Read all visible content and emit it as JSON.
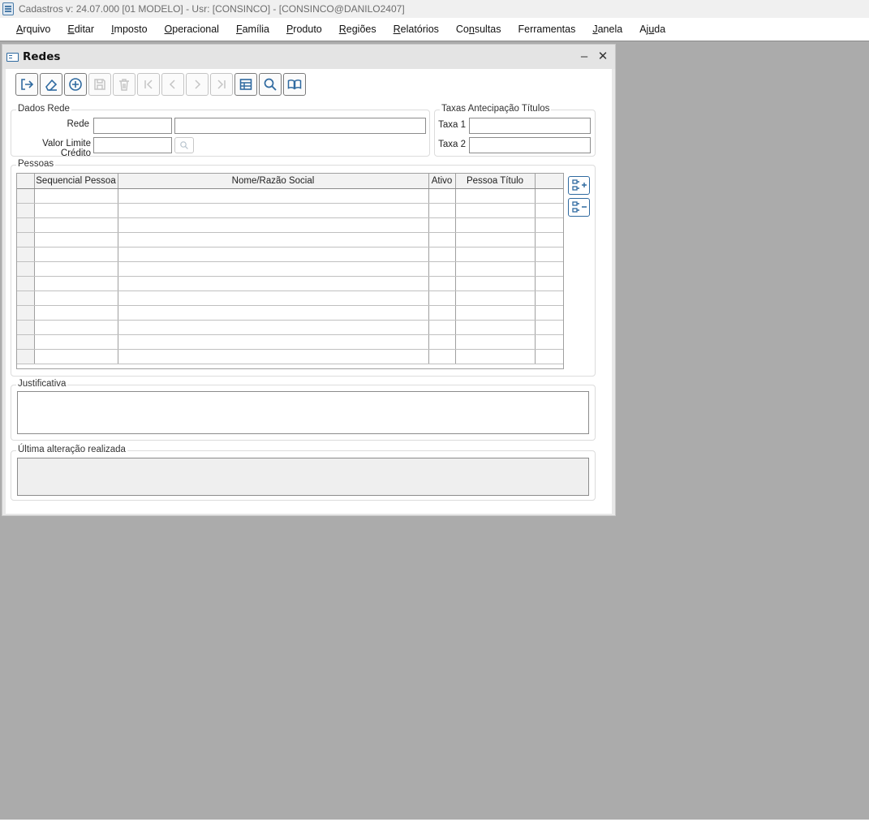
{
  "app": {
    "title": "Cadastros  v: 24.07.000   [01 MODELO] - Usr: [CONSINCO] - [CONSINCO@DANILO2407]"
  },
  "menu": [
    {
      "pre": "",
      "u": "A",
      "post": "rquivo"
    },
    {
      "pre": "",
      "u": "E",
      "post": "ditar"
    },
    {
      "pre": "",
      "u": "I",
      "post": "mposto"
    },
    {
      "pre": "",
      "u": "O",
      "post": "peracional"
    },
    {
      "pre": "",
      "u": "F",
      "post": "amília"
    },
    {
      "pre": "",
      "u": "P",
      "post": "roduto"
    },
    {
      "pre": "",
      "u": "R",
      "post": "egiões"
    },
    {
      "pre": "",
      "u": "R",
      "post": "elatórios"
    },
    {
      "pre": "Co",
      "u": "n",
      "post": "sultas"
    },
    {
      "pre": "Ferramentas",
      "u": "",
      "post": ""
    },
    {
      "pre": "",
      "u": "J",
      "post": "anela"
    },
    {
      "pre": "Aj",
      "u": "u",
      "post": "da"
    }
  ],
  "window": {
    "title": "Redes",
    "minimize": "–",
    "close": "✕"
  },
  "toolbar": {
    "icons": [
      "exit-icon",
      "eraser-icon",
      "add-circle-icon",
      "save-icon",
      "trash-icon",
      "first-record-icon",
      "previous-record-icon",
      "next-record-icon",
      "last-record-icon",
      "table-grid-icon",
      "search-icon",
      "book-icon"
    ]
  },
  "dados_rede": {
    "label": "Dados Rede",
    "rede_label": "Rede",
    "rede_code": "",
    "rede_name": "",
    "limite_label": "Valor Limite Crédito",
    "limite_value": ""
  },
  "taxas": {
    "label": "Taxas Antecipação Títulos",
    "taxa1_label": "Taxa 1",
    "taxa1_value": "",
    "taxa2_label": "Taxa 2",
    "taxa2_value": ""
  },
  "pessoas": {
    "label": "Pessoas",
    "columns": [
      "Sequencial Pessoa",
      "Nome/Razão Social",
      "Ativo",
      "Pessoa Título"
    ],
    "row_count": 12
  },
  "justificativa": {
    "label": "Justificativa",
    "value": ""
  },
  "ultima": {
    "label": "Última alteração realizada",
    "value": ""
  }
}
